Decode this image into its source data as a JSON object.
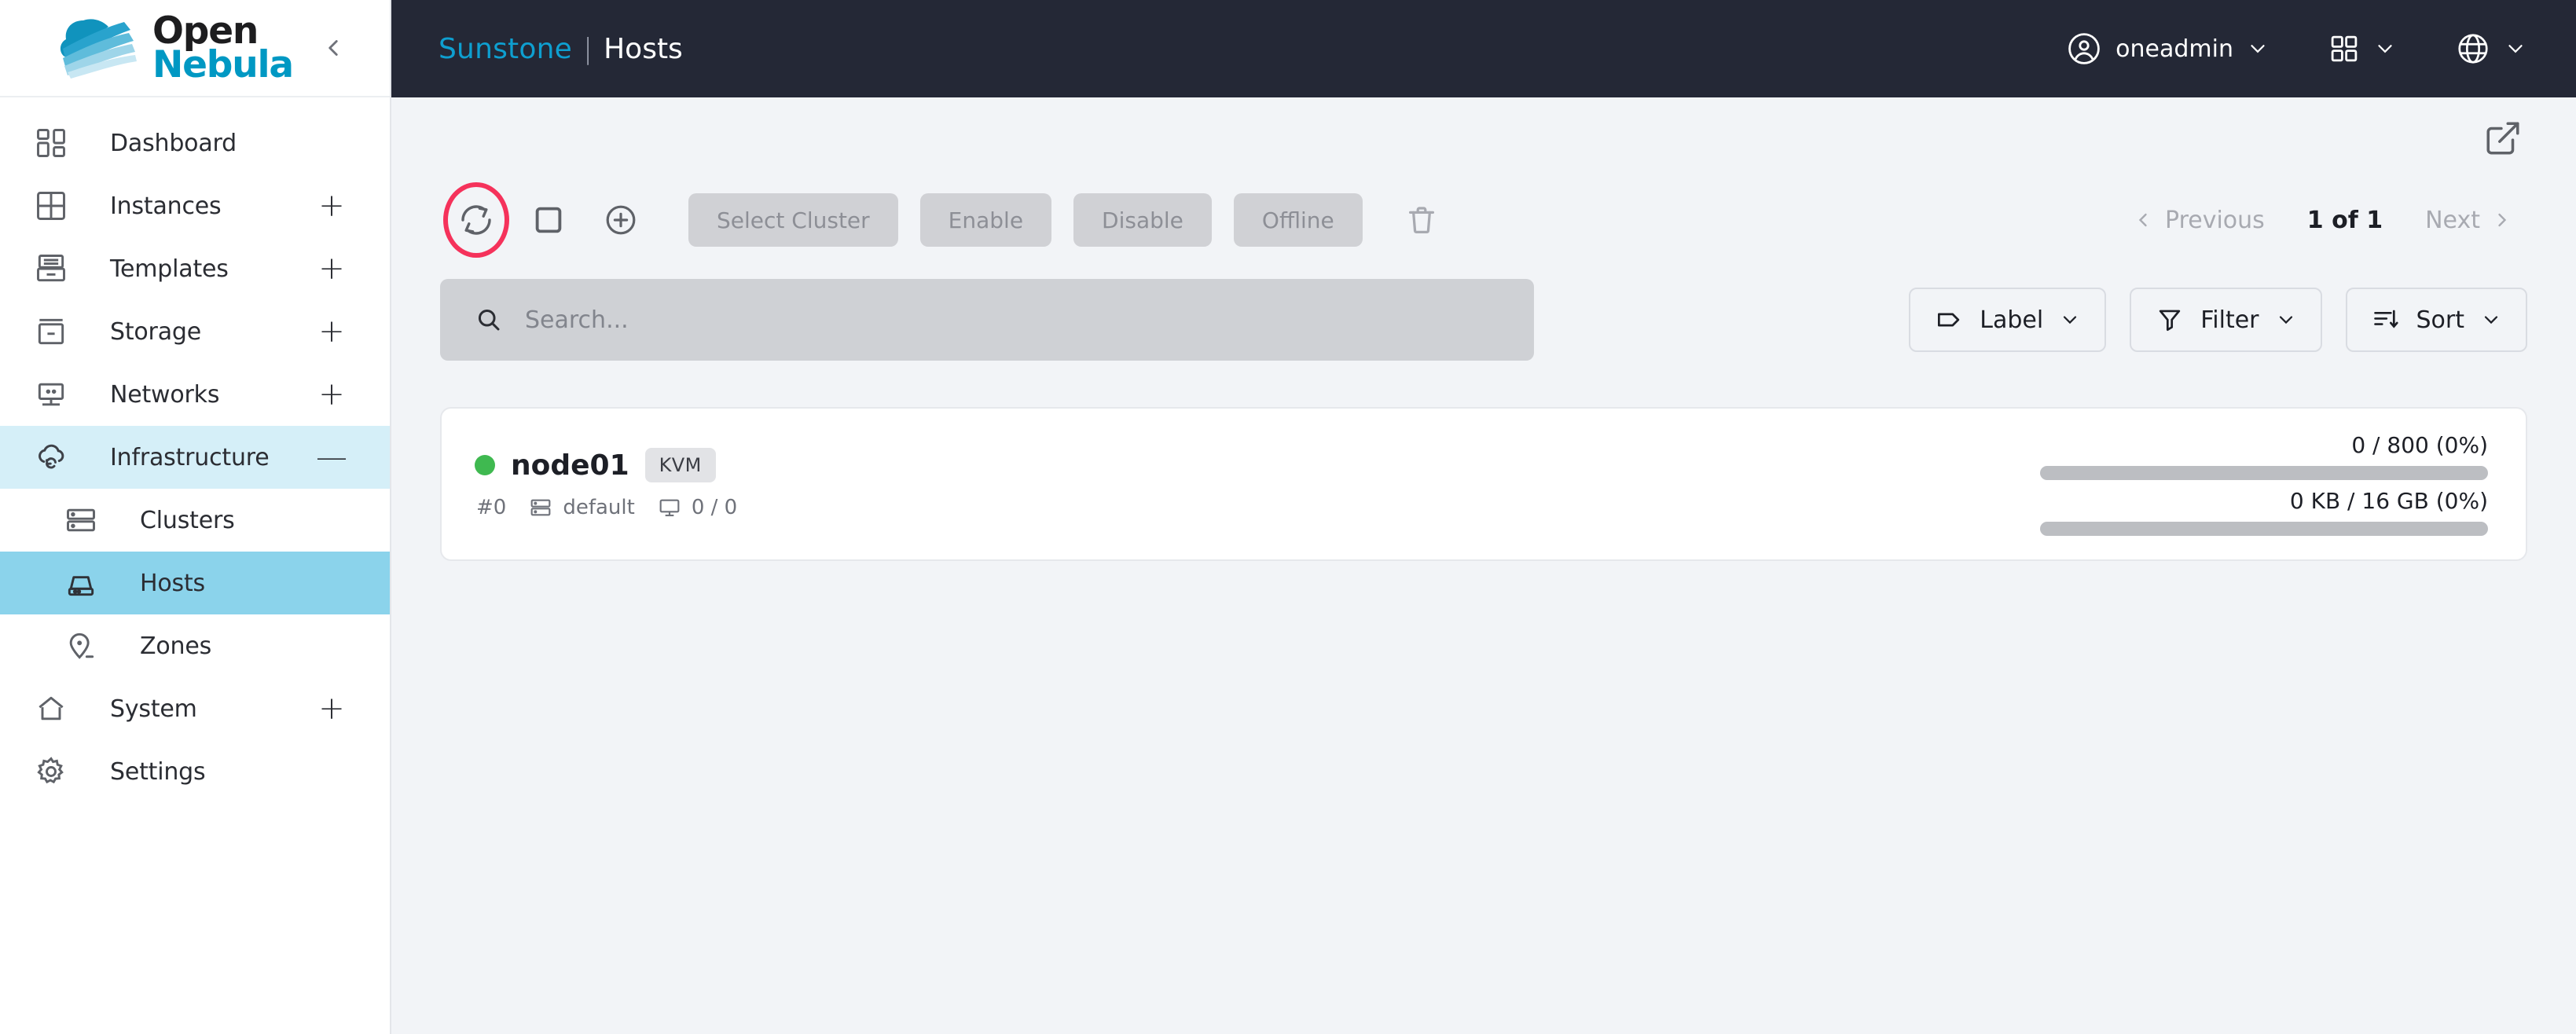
{
  "brand": {
    "logo_open": "Open",
    "logo_nebula": "Nebula",
    "collapse_icon": "chevron-left-icon"
  },
  "topbar": {
    "app_name": "Sunstone",
    "separator": "|",
    "page_name": "Hosts",
    "user": "oneadmin",
    "user_icon": "user-circle-icon",
    "apps_icon": "grid-apps-icon",
    "language_icon": "globe-icon",
    "chevron_icon": "chevron-down-icon"
  },
  "sidebar": {
    "items": [
      {
        "label": "Dashboard",
        "icon": "dashboard-icon",
        "action": "",
        "state": "normal"
      },
      {
        "label": "Instances",
        "icon": "instances-grid-icon",
        "action": "+",
        "state": "normal"
      },
      {
        "label": "Templates",
        "icon": "templates-drawer-icon",
        "action": "+",
        "state": "normal"
      },
      {
        "label": "Storage",
        "icon": "storage-box-icon",
        "action": "+",
        "state": "normal"
      },
      {
        "label": "Networks",
        "icon": "networks-monitor-icon",
        "action": "+",
        "state": "normal"
      },
      {
        "label": "Infrastructure",
        "icon": "cloud-sync-icon",
        "action": "—",
        "state": "expanded"
      },
      {
        "label": "Clusters",
        "icon": "clusters-rack-icon",
        "action": "",
        "state": "child"
      },
      {
        "label": "Hosts",
        "icon": "host-server-icon",
        "action": "",
        "state": "child-selected"
      },
      {
        "label": "Zones",
        "icon": "zone-pin-icon",
        "action": "",
        "state": "child"
      },
      {
        "label": "System",
        "icon": "system-home-icon",
        "action": "+",
        "state": "normal"
      },
      {
        "label": "Settings",
        "icon": "gear-icon",
        "action": "",
        "state": "normal"
      }
    ]
  },
  "toolbar": {
    "refresh_icon": "refresh-icon",
    "refresh_highlighted": true,
    "select_all_icon": "checkbox-empty-icon",
    "add_icon": "plus-circle-icon",
    "delete_icon": "trash-icon",
    "buttons": [
      {
        "label": "Select Cluster",
        "disabled": true
      },
      {
        "label": "Enable",
        "disabled": true
      },
      {
        "label": "Disable",
        "disabled": true
      },
      {
        "label": "Offline",
        "disabled": true
      }
    ],
    "external_link_icon": "external-link-icon"
  },
  "pagination": {
    "previous": "Previous",
    "page_info": "1 of 1",
    "next": "Next",
    "prev_icon": "chevron-left-icon",
    "next_icon": "chevron-right-icon"
  },
  "search": {
    "placeholder": "Search...",
    "value": "",
    "icon": "search-icon"
  },
  "filters": [
    {
      "label": "Label",
      "icon": "tag-icon"
    },
    {
      "label": "Filter",
      "icon": "funnel-icon"
    },
    {
      "label": "Sort",
      "icon": "sort-icon"
    }
  ],
  "hosts": [
    {
      "name": "node01",
      "hypervisor": "KVM",
      "status": "on",
      "status_color": "#3fb950",
      "id": "#0",
      "cluster": "default",
      "cluster_icon": "clusters-rack-icon",
      "vms_icon": "monitor-icon",
      "vms": "0 / 0",
      "cpu_label": "0 / 800 (0%)",
      "cpu_percent": 0,
      "memory_label": "0 KB / 16 GB (0%)",
      "memory_percent": 0
    }
  ],
  "colors": {
    "accent": "#0098c3",
    "topbar_bg": "#242836",
    "page_bg": "#f2f4f7",
    "sidebar_expanded": "#d5eff8",
    "sidebar_selected": "#8bd3eb",
    "highlight_ring": "#f5325b",
    "status_green": "#3fb950"
  }
}
